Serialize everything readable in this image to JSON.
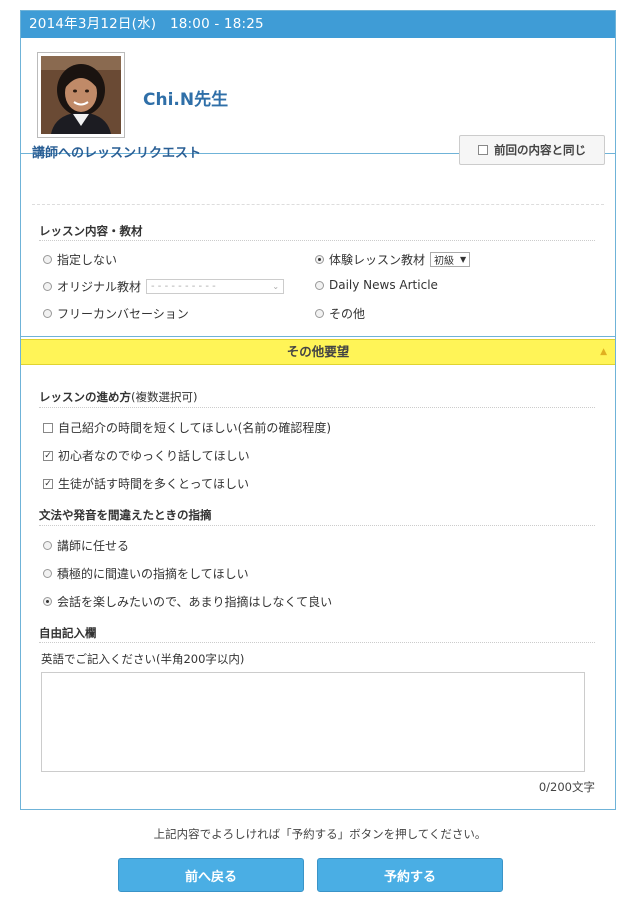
{
  "header": {
    "datetime": "2014年3月12日(水)　18:00 - 18:25"
  },
  "teacher": {
    "name": "Chi.N先生"
  },
  "request": {
    "title": "講師へのレッスンリクエスト",
    "same_as_last_label": "前回の内容と同じ",
    "same_as_last_checked": false
  },
  "content": {
    "title": "レッスン内容・教材",
    "options": {
      "none": {
        "label": "指定しない",
        "selected": false
      },
      "trial": {
        "label": "体験レッスン教材",
        "selected": true,
        "level": "初級"
      },
      "original": {
        "label": "オリジナル教材",
        "selected": false,
        "select_placeholder": "- - - - - - - - - -"
      },
      "daily_news": {
        "label": "Daily News Article",
        "selected": false
      },
      "free_conv": {
        "label": "フリーカンバセーション",
        "selected": false
      },
      "other": {
        "label": "その他",
        "selected": false
      }
    }
  },
  "other_requests": {
    "label": "その他要望"
  },
  "progress": {
    "title": "レッスンの進め方",
    "title_note": "(複数選択可)",
    "items": [
      {
        "label": "自己紹介の時間を短くしてほしい(名前の確認程度)",
        "checked": false
      },
      {
        "label": "初心者なのでゆっくり話してほしい",
        "checked": true
      },
      {
        "label": "生徒が話す時間を多くとってほしい",
        "checked": true
      }
    ]
  },
  "correction": {
    "title": "文法や発音を間違えたときの指摘",
    "items": [
      {
        "label": "講師に任せる",
        "selected": false
      },
      {
        "label": "積極的に間違いの指摘をしてほしい",
        "selected": false
      },
      {
        "label": "会話を楽しみたいので、あまり指摘はしなくて良い",
        "selected": true
      }
    ]
  },
  "free": {
    "title": "自由記入欄",
    "note": "英語でご記入ください(半角200字以内)",
    "value": "",
    "counter": "0/200文字"
  },
  "footer": {
    "note": "上記内容でよろしければ「予約する」ボタンを押してください。",
    "back_label": "前へ戻る",
    "reserve_label": "予約する"
  },
  "colors": {
    "header": "#3f9cd6",
    "accent": "#2f6fa8",
    "yellow": "#fff457",
    "button": "#4aaee4"
  }
}
